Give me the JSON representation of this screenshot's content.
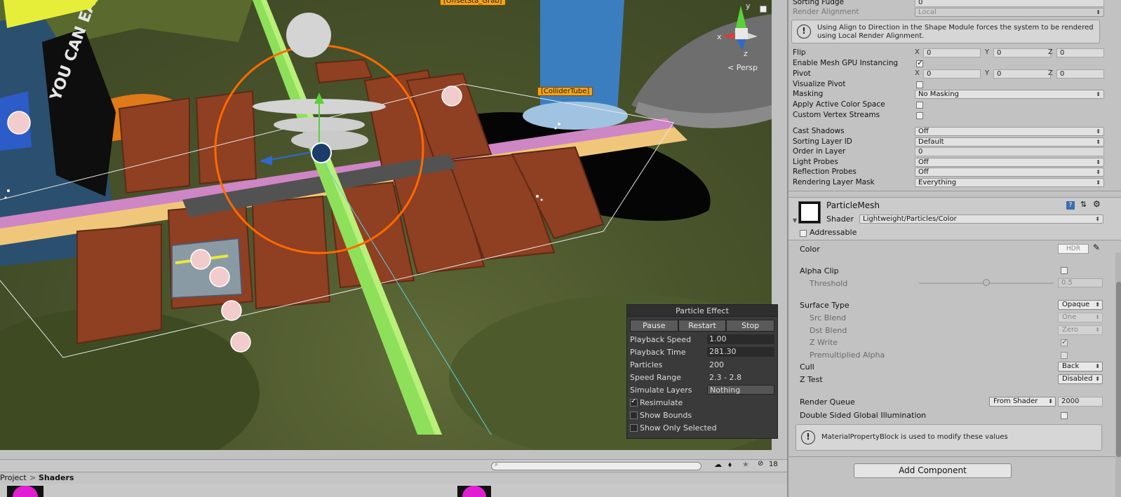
{
  "scene": {
    "labels": {
      "offset_grab": "[OffsetSta_Grab]",
      "collider_tube": "[ColliderTube]"
    },
    "gizmo": {
      "persp": "< Persp",
      "axis_x": "x",
      "axis_y": "y",
      "axis_z": "z"
    },
    "artwork_text": "YOU CAN EAT",
    "particle_effect": {
      "title": "Particle Effect",
      "buttons": {
        "pause": "Pause",
        "restart": "Restart",
        "stop": "Stop"
      },
      "playback_speed": {
        "label": "Playback Speed",
        "value": "1.00"
      },
      "playback_time": {
        "label": "Playback Time",
        "value": "281.30"
      },
      "particles": {
        "label": "Particles",
        "value": "200"
      },
      "speed_range": {
        "label": "Speed Range",
        "value": "2.3 - 2.8"
      },
      "simulate_layers": {
        "label": "Simulate Layers",
        "value": "Nothing"
      },
      "resimulate": {
        "label": "Resimulate",
        "checked": true
      },
      "show_bounds": {
        "label": "Show Bounds",
        "checked": false
      },
      "show_only_selected": {
        "label": "Show Only Selected",
        "checked": false
      }
    },
    "toolbar": {
      "hidden_count": "18"
    }
  },
  "project": {
    "breadcrumb_root": "Project",
    "breadcrumb_sep": ">",
    "breadcrumb_current": "Shaders"
  },
  "renderer": {
    "sorting_fudge": {
      "label": "Sorting Fudge",
      "value": "0"
    },
    "render_alignment": {
      "label": "Render Alignment",
      "value": "Local"
    },
    "align_help": "Using Align to Direction in the Shape Module forces the system to be rendered using Local Render Alignment.",
    "flip": {
      "label": "Flip",
      "x": "0",
      "y": "0",
      "z": "0"
    },
    "gpu_instancing": {
      "label": "Enable Mesh GPU Instancing",
      "checked": true
    },
    "pivot": {
      "label": "Pivot",
      "x": "0",
      "y": "0",
      "z": "0"
    },
    "visualize_pivot": {
      "label": "Visualize Pivot",
      "checked": false
    },
    "masking": {
      "label": "Masking",
      "value": "No Masking"
    },
    "active_color_space": {
      "label": "Apply Active Color Space",
      "checked": false
    },
    "custom_vertex_streams": {
      "label": "Custom Vertex Streams",
      "checked": false
    },
    "cast_shadows": {
      "label": "Cast Shadows",
      "value": "Off"
    },
    "sorting_layer": {
      "label": "Sorting Layer ID",
      "value": "Default"
    },
    "order_in_layer": {
      "label": "Order in Layer",
      "value": "0"
    },
    "light_probes": {
      "label": "Light Probes",
      "value": "Off"
    },
    "reflection_probes": {
      "label": "Reflection Probes",
      "value": "Off"
    },
    "rendering_layer_mask": {
      "label": "Rendering Layer Mask",
      "value": "Everything"
    },
    "axis": {
      "x": "X",
      "y": "Y",
      "z": "Z"
    }
  },
  "material": {
    "name": "ParticleMesh",
    "shader_label": "Shader",
    "shader_value": "Lightweight/Particles/Color",
    "addressable": "Addressable",
    "color": {
      "label": "Color",
      "hdr": "HDR"
    },
    "alpha_clip": {
      "label": "Alpha Clip",
      "checked": false
    },
    "threshold": {
      "label": "Threshold",
      "value": "0.5",
      "level": 0.5
    },
    "surface_type": {
      "label": "Surface Type",
      "value": "Opaque"
    },
    "src_blend": {
      "label": "Src Blend",
      "value": "One"
    },
    "dst_blend": {
      "label": "Dst Blend",
      "value": "Zero"
    },
    "z_write": {
      "label": "Z Write",
      "checked": true
    },
    "premultiplied_alpha": {
      "label": "Premultiplied Alpha",
      "checked": false
    },
    "cull": {
      "label": "Cull",
      "value": "Back"
    },
    "z_test": {
      "label": "Z Test",
      "value": "Disabled"
    },
    "render_queue": {
      "label": "Render Queue",
      "mode": "From Shader",
      "value": "2000"
    },
    "double_sided_gi": {
      "label": "Double Sided Global Illumination",
      "checked": false
    },
    "mpb_help": "MaterialPropertyBlock is used to modify these values"
  },
  "add_component": "Add Component"
}
